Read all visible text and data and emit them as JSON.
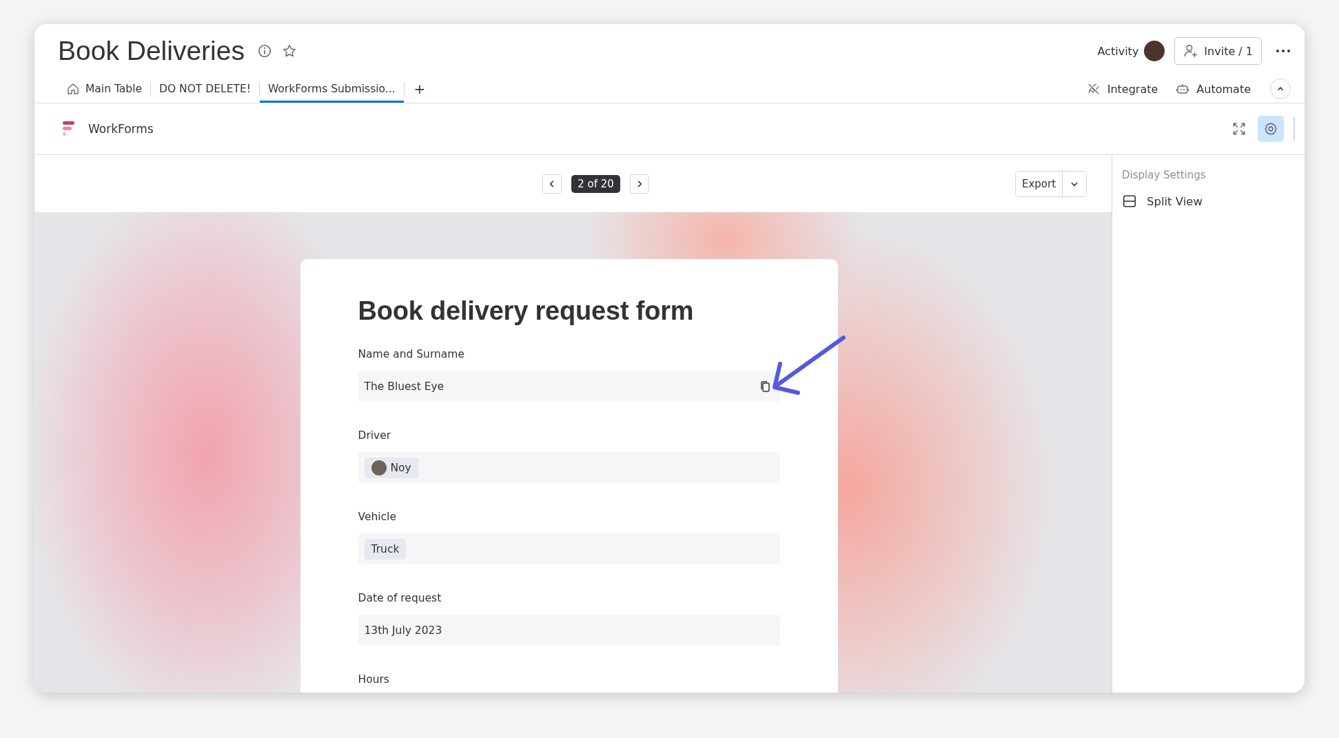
{
  "board": {
    "title": "Book Deliveries"
  },
  "header_actions": {
    "activity": "Activity",
    "invite": "Invite / 1"
  },
  "tabs": [
    {
      "label": "Main Table",
      "selected": false,
      "kind": "home"
    },
    {
      "label": "DO NOT DELETE!",
      "selected": false,
      "kind": "plain"
    },
    {
      "label": "WorkForms Submissio...",
      "selected": true,
      "kind": "plain"
    }
  ],
  "add_tab": "+",
  "board_actions": [
    {
      "label": "Integrate",
      "kind": "integrate"
    },
    {
      "label": "Automate",
      "kind": "automate"
    }
  ],
  "app_bar": {
    "name": "WorkForms",
    "settings_selected": true
  },
  "pager": {
    "reading": "2 of 20"
  },
  "export": {
    "label": "Export"
  },
  "display_settings": {
    "heading": "Display Settings",
    "items": [
      {
        "label": "Split View"
      }
    ]
  },
  "form": {
    "title": "Book delivery request form",
    "fields": [
      {
        "label": "Name and Surname",
        "kind": "text",
        "value": "The Bluest Eye",
        "copyable": true
      },
      {
        "label": "Driver",
        "kind": "person",
        "value": "Noy"
      },
      {
        "label": "Vehicle",
        "kind": "tag",
        "value": "Truck"
      },
      {
        "label": "Date of request",
        "kind": "text",
        "value": "13th July 2023"
      },
      {
        "label": "Hours"
      }
    ]
  }
}
